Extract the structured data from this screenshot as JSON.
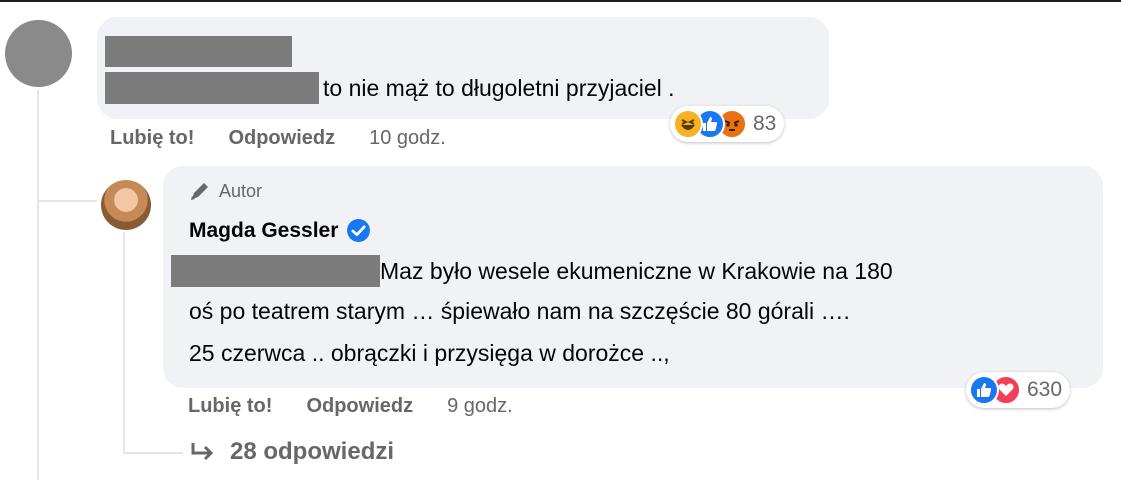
{
  "comment": {
    "text": "to nie mąż to długoletni przyjaciel .",
    "actions": {
      "like": "Lubię to!",
      "reply": "Odpowiedz",
      "time": "10 godz."
    },
    "reactions": {
      "icons": [
        "haha-icon",
        "like-icon",
        "angry-icon"
      ],
      "count": "83"
    }
  },
  "reply": {
    "badge": "Autor",
    "author": "Magda Gessler",
    "lines": [
      "Maz było wesele ekumeniczne w Krakowie na 180",
      "oś po teatrem starym … śpiewało nam na szczęście 80 górali ….",
      "25 czerwca .. obrączki i przysięga w dorożce ..,"
    ],
    "actions": {
      "like": "Lubię to!",
      "reply": "Odpowiedz",
      "time": "9 godz."
    },
    "reactions": {
      "icons": [
        "like-icon",
        "love-icon"
      ],
      "count": "630"
    }
  },
  "more_replies": "28 odpowiedzi",
  "colors": {
    "like_blue": "#1877f2",
    "love_red": "#f33e58",
    "haha_yellow": "#f7b125",
    "angry_orange": "#e9710f",
    "secondary_text": "#65676b",
    "bubble_bg": "#f0f2f5"
  }
}
